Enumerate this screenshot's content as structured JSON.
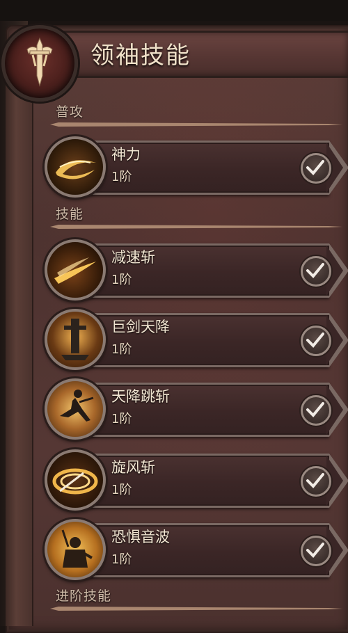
{
  "panel": {
    "title": "领袖技能",
    "emblem_icon": "sword-emblem-icon"
  },
  "sections": [
    {
      "label": "普攻",
      "skills": [
        {
          "name": "神力",
          "level": "1阶",
          "icon": "golden-swirl-icon",
          "selected": true
        }
      ]
    },
    {
      "label": "技能",
      "skills": [
        {
          "name": "减速斩",
          "level": "1阶",
          "icon": "slash-wave-icon",
          "selected": true
        },
        {
          "name": "巨剑天降",
          "level": "1阶",
          "icon": "giant-sword-icon",
          "selected": true
        },
        {
          "name": "天降跳斩",
          "level": "1阶",
          "icon": "leap-slash-icon",
          "selected": true
        },
        {
          "name": "旋风斩",
          "level": "1阶",
          "icon": "whirlwind-icon",
          "selected": true
        },
        {
          "name": "恐惧音波",
          "level": "1阶",
          "icon": "fear-roar-icon",
          "selected": true
        }
      ]
    },
    {
      "label": "进阶技能",
      "skills": []
    }
  ],
  "colors": {
    "panel_bg": "#553734",
    "title_text": "#efe0c8",
    "label_text": "#cdb9a6",
    "icon_gold": "#f2b24a"
  }
}
